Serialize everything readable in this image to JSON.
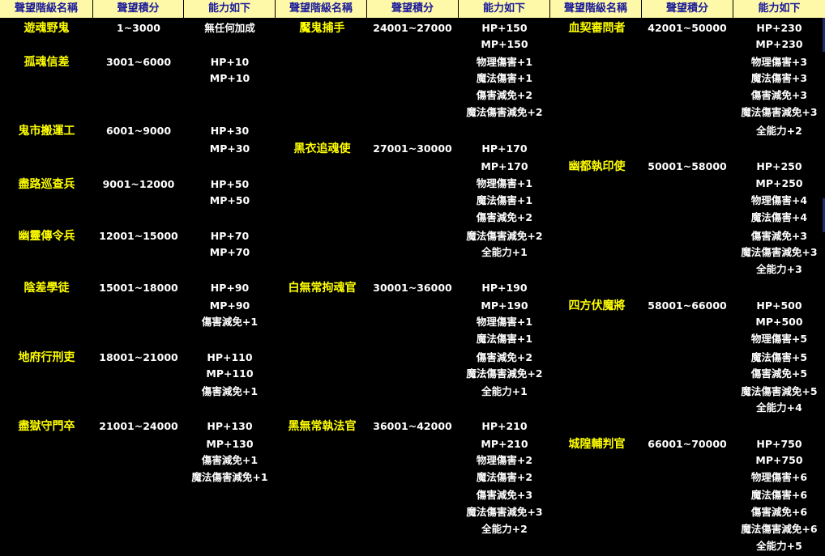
{
  "header": {
    "name_label": "聲望階級名稱",
    "points_label": "聲望積分",
    "ability_label": "能力如下"
  },
  "sections": [
    {
      "ranks": [
        {
          "name": "遊魂野鬼",
          "range": "1~3000",
          "abilities": [
            "無任何加成"
          ]
        },
        {
          "name": "孤魂信差",
          "range": "3001~6000",
          "abilities": [
            "HP+10",
            "MP+10"
          ]
        },
        {
          "name": "鬼市搬運工",
          "range": "6001~9000",
          "abilities": [
            "HP+30",
            "MP+30"
          ]
        },
        {
          "name": "盡路巡查兵",
          "range": "9001~12000",
          "abilities": [
            "HP+50",
            "MP+50"
          ]
        },
        {
          "name": "幽靈傳令兵",
          "range": "12001~15000",
          "abilities": [
            "HP+70",
            "MP+70"
          ]
        },
        {
          "name": "陰差學徒",
          "range": "15001~18000",
          "abilities": [
            "HP+90",
            "MP+90",
            "傷害減免+1"
          ]
        },
        {
          "name": "地府行刑吏",
          "range": "18001~21000",
          "abilities": [
            "HP+110",
            "MP+110",
            "傷害減免+1"
          ]
        },
        {
          "name": "盡獄守門卒",
          "range": "21001~24000",
          "abilities": [
            "HP+130",
            "MP+130",
            "傷害減免+1",
            "魔法傷害減免+1"
          ]
        }
      ]
    },
    {
      "ranks": [
        {
          "name": "魘鬼捕手",
          "range": "24001~27000",
          "abilities": [
            "HP+150",
            "MP+150",
            "物理傷害+1",
            "魔法傷害+1",
            "傷害減免+2",
            "魔法傷害減免+2"
          ]
        },
        {
          "name": "黑衣追魂使",
          "range": "27001~30000",
          "abilities": [
            "HP+170",
            "MP+170",
            "物理傷害+1",
            "魔法傷害+1",
            "傷害減免+2",
            "魔法傷害減免+2",
            "全能力+1"
          ]
        },
        {
          "name": "白無常拘魂官",
          "range": "30001~36000",
          "abilities": [
            "HP+190",
            "MP+190",
            "物理傷害+1",
            "魔法傷害+1",
            "傷害減免+2",
            "魔法傷害減免+2",
            "全能力+1"
          ]
        },
        {
          "name": "黑無常執法官",
          "range": "36001~42000",
          "abilities": [
            "HP+210",
            "MP+210",
            "物理傷害+2",
            "魔法傷害+2",
            "傷害減免+3",
            "魔法傷害減免+3",
            "全能力+2"
          ]
        }
      ]
    },
    {
      "ranks": [
        {
          "name": "血契審問者",
          "range": "42001~50000",
          "abilities": [
            "HP+230",
            "MP+230",
            "物理傷害+3",
            "魔法傷害+3",
            "傷害減免+3",
            "魔法傷害減免+3",
            "全能力+2"
          ]
        },
        {
          "name": "幽都執印使",
          "range": "50001~58000",
          "abilities": [
            "HP+250",
            "MP+250",
            "物理傷害+4",
            "魔法傷害+4",
            "傷害減免+3",
            "魔法傷害減免+3",
            "全能力+3"
          ]
        },
        {
          "name": "四方伏魔將",
          "range": "58001~66000",
          "abilities": [
            "HP+500",
            "MP+500",
            "物理傷害+5",
            "魔法傷害+5",
            "傷害減免+5",
            "魔法傷害減免+5",
            "全能力+4"
          ]
        },
        {
          "name": "城隍輔判官",
          "range": "66001~70000",
          "abilities": [
            "HP+750",
            "MP+750",
            "物理傷害+6",
            "魔法傷害+6",
            "傷害減免+6",
            "魔法傷害減免+6",
            "全能力+5"
          ]
        }
      ]
    }
  ]
}
